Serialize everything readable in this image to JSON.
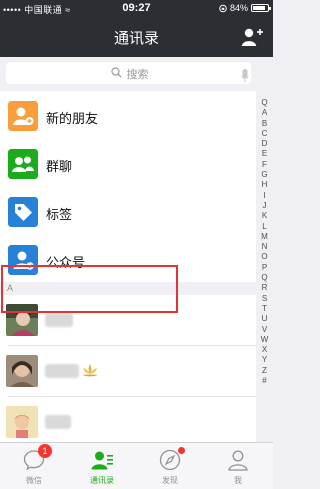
{
  "status_bar": {
    "carrier": "••••• 中国联通 ≈",
    "time": "09:27",
    "battery": "84%",
    "battery_level": 0.84
  },
  "header": {
    "title": "通讯录"
  },
  "search": {
    "placeholder": "搜索"
  },
  "menu": [
    {
      "label": "新的朋友",
      "icon": "add-friend-icon",
      "color": "#fa9d3b"
    },
    {
      "label": "群聊",
      "icon": "group-chat-icon",
      "color": "#1aad19"
    },
    {
      "label": "标签",
      "icon": "tag-icon",
      "color": "#2782d7"
    },
    {
      "label": "公众号",
      "icon": "official-account-icon",
      "color": "#2782d7"
    }
  ],
  "section_letter": "A",
  "index_letters": [
    "Q",
    "A",
    "B",
    "C",
    "D",
    "E",
    "F",
    "G",
    "H",
    "I",
    "J",
    "K",
    "L",
    "M",
    "N",
    "O",
    "P",
    "Q",
    "R",
    "S",
    "T",
    "U",
    "V",
    "W",
    "X",
    "Y",
    "Z",
    "#"
  ],
  "tabs": [
    {
      "label": "微信",
      "icon": "chat-bubble-icon",
      "badge": "1"
    },
    {
      "label": "通讯录",
      "icon": "contacts-icon",
      "active": true
    },
    {
      "label": "发现",
      "icon": "compass-icon"
    },
    {
      "label": "我",
      "icon": "person-icon"
    }
  ],
  "colors": {
    "header_bg": "#2b2e33",
    "accent": "#1aad19",
    "highlight_border": "#e53236",
    "badge": "#f43530"
  }
}
